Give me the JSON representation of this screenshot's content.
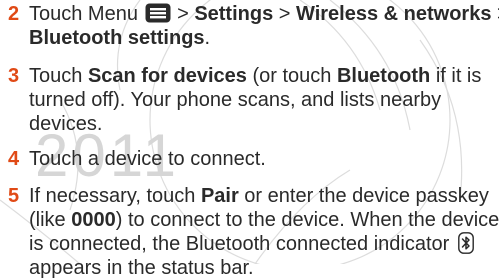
{
  "colors": {
    "step_number": "#e04a16",
    "text": "#2a2a2a",
    "watermark": "#d6d6d6"
  },
  "watermark": {
    "year": "2011"
  },
  "steps": [
    {
      "number": "2",
      "l1_a": "Touch Menu ",
      "l1_icon": "menu-icon",
      "l1_b": " > ",
      "l1_c": "Settings",
      "l1_d": " > ",
      "l1_e": "Wireless & networks",
      "l1_f": " >",
      "l2_a": "Bluetooth settings",
      "l2_b": "."
    },
    {
      "number": "3",
      "l1_a": "Touch ",
      "l1_b": "Scan for devices",
      "l1_c": " (or touch ",
      "l1_d": "Bluetooth",
      "l1_e": " if it is",
      "l2": "turned off). Your phone scans, and lists nearby",
      "l3": "devices."
    },
    {
      "number": "4",
      "l1": "Touch a device to connect."
    },
    {
      "number": "5",
      "l1_a": "If necessary, touch ",
      "l1_b": "Pair",
      "l1_c": " or enter the device passkey",
      "l2_a": "(like ",
      "l2_b": "0000",
      "l2_c": ") to connect to the device. When the device",
      "l3_a": "is connected, the Bluetooth connected indicator ",
      "l3_icon": "bluetooth-connected-icon",
      "l4": "appears in the status bar."
    }
  ]
}
